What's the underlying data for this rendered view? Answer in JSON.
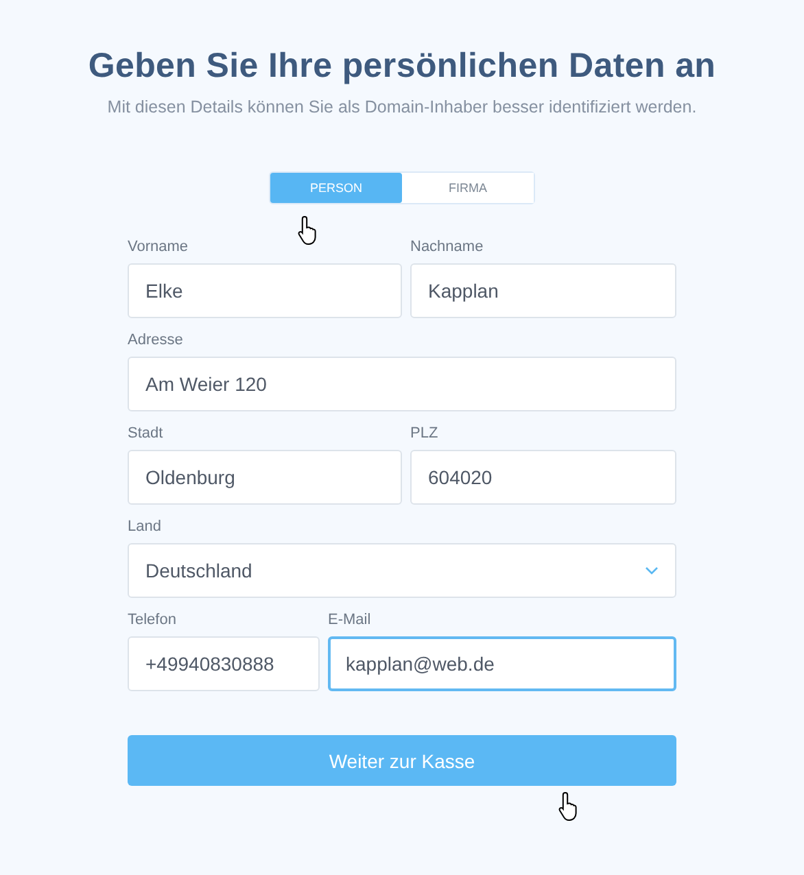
{
  "title": "Geben Sie Ihre persönlichen Daten an",
  "subtitle": "Mit diesen Details können Sie als Domain-Inhaber besser identifiziert werden.",
  "toggle": [
    {
      "label": "PERSON",
      "selected": true
    },
    {
      "label": "FIRMA",
      "selected": false
    }
  ],
  "rows": [
    [
      {
        "kind": "text",
        "label": "Vorname",
        "value": "Elke",
        "focused": false
      },
      {
        "kind": "text",
        "label": "Nachname",
        "value": "Kapplan",
        "focused": false
      }
    ],
    [
      {
        "kind": "text",
        "label": "Adresse",
        "value": "Am Weier 120",
        "focused": false
      }
    ],
    [
      {
        "kind": "text",
        "label": "Stadt",
        "value": "Oldenburg",
        "focused": false
      },
      {
        "kind": "text",
        "label": "PLZ",
        "value": "604020",
        "focused": false
      }
    ],
    [
      {
        "kind": "select",
        "label": "Land",
        "value": "Deutschland",
        "focused": false
      }
    ],
    [
      {
        "kind": "text",
        "label": "Telefon",
        "value": "+49940830888",
        "focused": false
      },
      {
        "kind": "text",
        "label": "E-Mail",
        "value": "kapplan@web.de",
        "focused": true
      }
    ]
  ],
  "submit": "Weiter zur Kasse"
}
